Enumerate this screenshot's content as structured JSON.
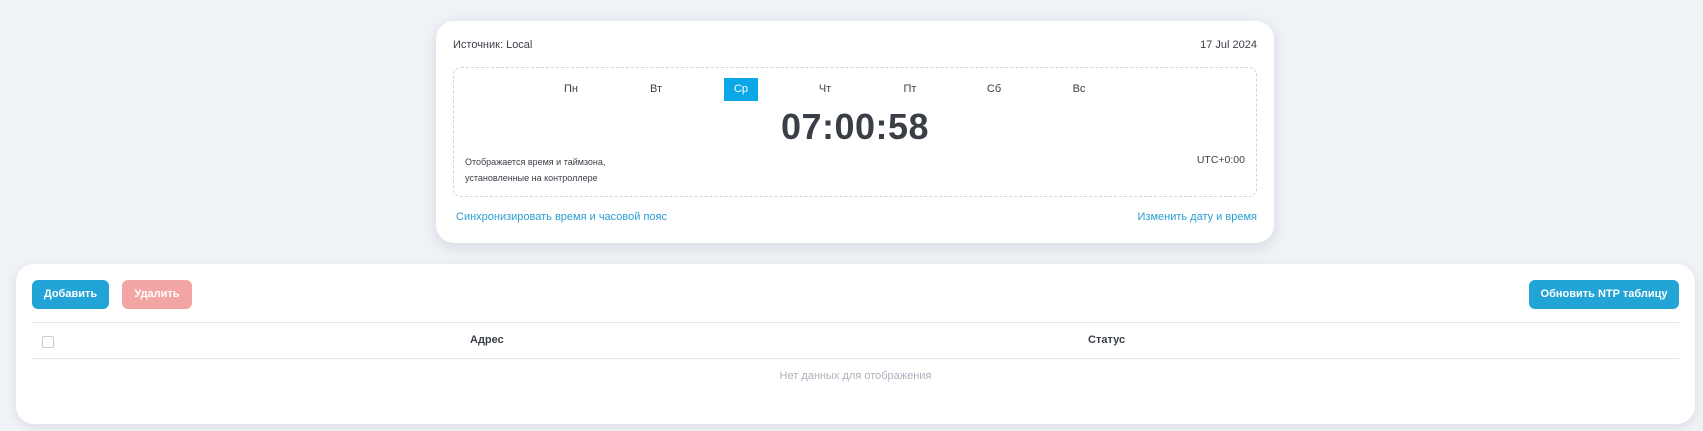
{
  "clock": {
    "source_label": "Источник: Local",
    "date": "17 Jul 2024",
    "days": [
      {
        "label": "Пн",
        "active": false
      },
      {
        "label": "Вт",
        "active": false
      },
      {
        "label": "Ср",
        "active": true
      },
      {
        "label": "Чт",
        "active": false
      },
      {
        "label": "Пт",
        "active": false
      },
      {
        "label": "Сб",
        "active": false
      },
      {
        "label": "Вс",
        "active": false
      }
    ],
    "time": "07:00:58",
    "note_line1": "Отображается время и таймзона,",
    "note_line2": "установленные на контроллере",
    "timezone": "UTC+0:00",
    "sync_link": "Синхронизировать время и часовой пояс",
    "change_link": "Изменить дату и время"
  },
  "ntp": {
    "add_button": "Добавить",
    "delete_button": "Удалить",
    "refresh_button": "Обновить NTP таблицу",
    "columns": [
      "Адрес",
      "Статус"
    ],
    "empty_text": "Нет данных для отображения"
  },
  "colors": {
    "accent": "#22a4d6",
    "active_day": "#0aa8e6",
    "danger_disabled": "#f3a5a3",
    "background": "#eff2f6"
  }
}
